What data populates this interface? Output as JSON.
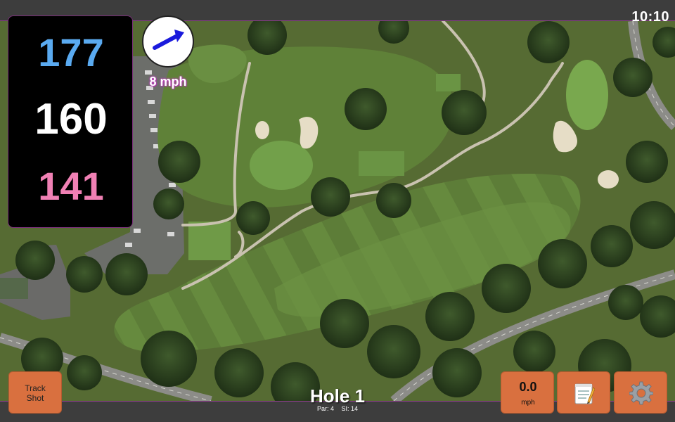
{
  "status_bar": {
    "time": "10:10"
  },
  "yardages": {
    "back": "177",
    "middle": "160",
    "front": "141"
  },
  "wind": {
    "speed_label": "8 mph",
    "direction": "east-northeast"
  },
  "hole": {
    "title": "Hole 1",
    "par_label": "Par: 4",
    "si_label": "SI: 14"
  },
  "buttons": {
    "track_shot_line1": "Track",
    "track_shot_line2": "Shot",
    "speed_value": "0.0",
    "speed_unit": "mph",
    "notes_icon": "notepad-icon",
    "settings_icon": "gear-icon"
  },
  "colors": {
    "back_yardage": "#5aaaf0",
    "middle_yardage": "#ffffff",
    "front_yardage": "#f080b4",
    "button": "#d9703f",
    "accent_border": "#8b3d8b"
  }
}
